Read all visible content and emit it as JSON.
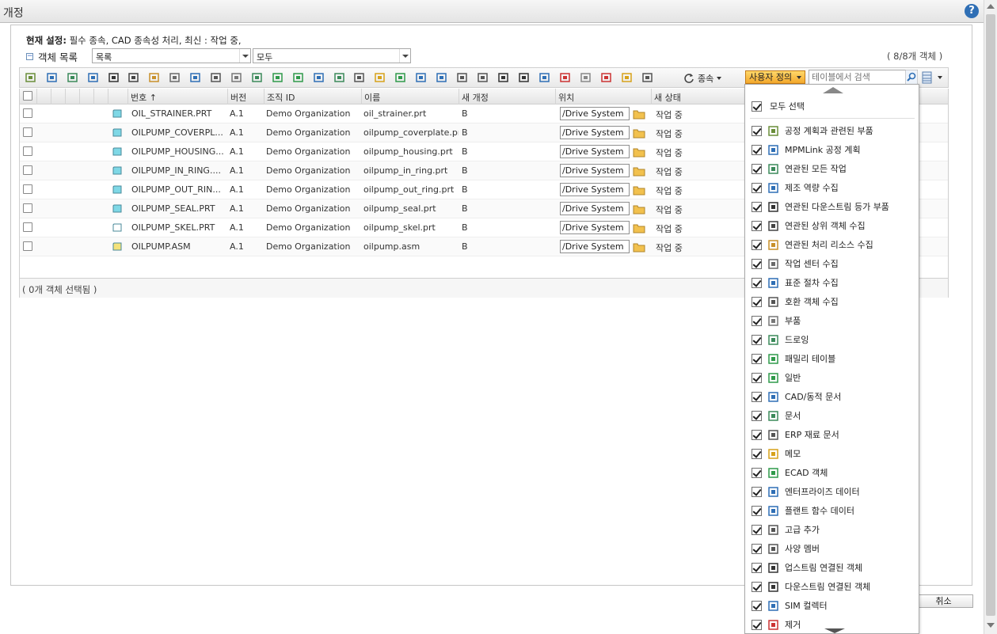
{
  "window": {
    "title": "개정",
    "help_icon": "help-icon"
  },
  "settings": {
    "label": "현재 설정:",
    "text": " 필수 종속, CAD 종속성 처리, 최신 : 작업 중,"
  },
  "object_list": {
    "label": "객체 목록",
    "view_select": "목록",
    "filter_select": "모두",
    "count": "( 8/8개 객체 )"
  },
  "toolbar": {
    "dependency_label": "종속",
    "customize_label": "사용자 정의",
    "search_placeholder": "테이블에서 검색"
  },
  "table": {
    "columns": [
      "번호 ↑",
      "버전",
      "조직 ID",
      "이름",
      "새 개정",
      "위치",
      "새 상태"
    ],
    "rows": [
      {
        "number": "OIL_STRAINER.PRT",
        "version": "A.1",
        "org": "Demo Organization",
        "name": "oil_strainer.prt",
        "new_rev": "B",
        "location": "/Drive System",
        "new_state": "작업 중",
        "icon": "part"
      },
      {
        "number": "OILPUMP_COVERPL...",
        "version": "A.1",
        "org": "Demo Organization",
        "name": "oilpump_coverplate.prt",
        "new_rev": "B",
        "location": "/Drive System",
        "new_state": "작업 중",
        "icon": "part"
      },
      {
        "number": "OILPUMP_HOUSING...",
        "version": "A.1",
        "org": "Demo Organization",
        "name": "oilpump_housing.prt",
        "new_rev": "B",
        "location": "/Drive System",
        "new_state": "작업 중",
        "icon": "part"
      },
      {
        "number": "OILPUMP_IN_RING....",
        "version": "A.1",
        "org": "Demo Organization",
        "name": "oilpump_in_ring.prt",
        "new_rev": "B",
        "location": "/Drive System",
        "new_state": "작업 중",
        "icon": "part"
      },
      {
        "number": "OILPUMP_OUT_RIN...",
        "version": "A.1",
        "org": "Demo Organization",
        "name": "oilpump_out_ring.prt",
        "new_rev": "B",
        "location": "/Drive System",
        "new_state": "작업 중",
        "icon": "part"
      },
      {
        "number": "OILPUMP_SEAL.PRT",
        "version": "A.1",
        "org": "Demo Organization",
        "name": "oilpump_seal.prt",
        "new_rev": "B",
        "location": "/Drive System",
        "new_state": "작업 중",
        "icon": "part"
      },
      {
        "number": "OILPUMP_SKEL.PRT",
        "version": "A.1",
        "org": "Demo Organization",
        "name": "oilpump_skel.prt",
        "new_rev": "B",
        "location": "/Drive System",
        "new_state": "작업 중",
        "icon": "skeleton"
      },
      {
        "number": "OILPUMP.ASM",
        "version": "A.1",
        "org": "Demo Organization",
        "name": "oilpump.asm",
        "new_rev": "B",
        "location": "/Drive System",
        "new_state": "작업 중",
        "icon": "assembly"
      }
    ],
    "footer": "( 0개 객체 선택됨 )"
  },
  "dropdown": {
    "select_all": "모두 선택",
    "items": [
      "공정 계획과 관련된 부품",
      "MPMLink 공정 계획",
      "연관된 모든 작업",
      "제조 역량 수집",
      "연관된 다운스트림 등가 부품",
      "연관된 상위 객체 수집",
      "연관된 처리 리소스 수집",
      "작업 센터 수집",
      "표준 절차 수집",
      "호환 객체 수집",
      "부품",
      "드로잉",
      "패밀리 테이블",
      "일반",
      "CAD/동적 문서",
      "문서",
      "ERP 재료 문서",
      "메모",
      "ECAD 객체",
      "엔터프라이즈 데이터",
      "플랜트 함수 데이터",
      "고급 추가",
      "사양 멤버",
      "업스트림 연결된 객체",
      "다운스트림 연결된 객체",
      "SIM 컬렉터",
      "제거"
    ]
  },
  "buttons": {
    "cancel": "취소"
  },
  "colors": {
    "accent_orange": "#f3a82c",
    "part_cyan": "#7fd8e6",
    "folder_yellow": "#f2c14e",
    "link_blue": "#2f6fb5"
  }
}
